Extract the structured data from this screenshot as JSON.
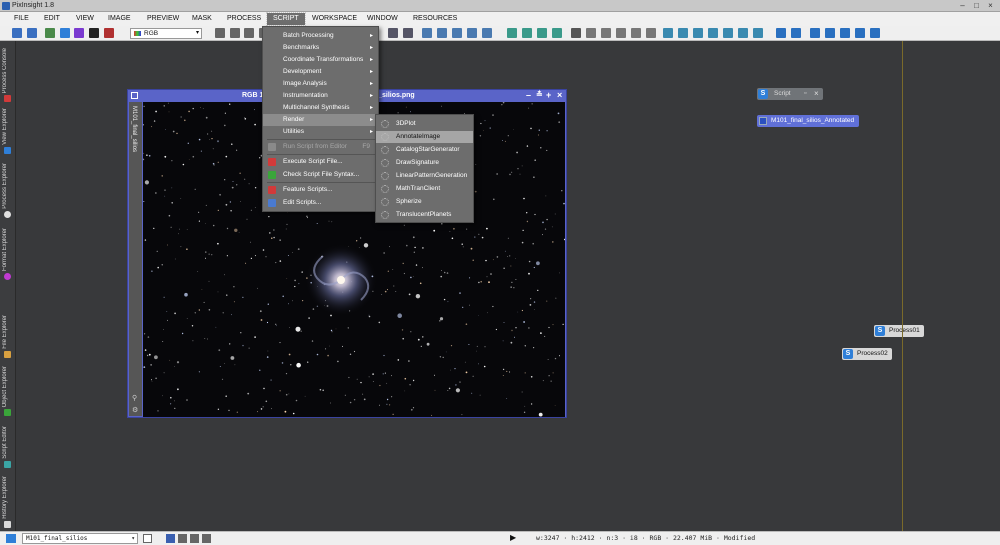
{
  "window": {
    "title": "PixInsight 1.8"
  },
  "menubar": {
    "items": [
      {
        "label": "FILE"
      },
      {
        "label": "EDIT"
      },
      {
        "label": "VIEW"
      },
      {
        "label": "IMAGE"
      },
      {
        "label": "PREVIEW"
      },
      {
        "label": "MASK"
      },
      {
        "label": "PROCESS"
      },
      {
        "label": "SCRIPT"
      },
      {
        "label": "WORKSPACE"
      },
      {
        "label": "WINDOW"
      },
      {
        "label": "RESOURCES"
      }
    ],
    "active": "SCRIPT"
  },
  "toolbar": {
    "channel_select": "RGB"
  },
  "sidebar": {
    "tabs": [
      {
        "label": "Process Console",
        "icon": "console-icon",
        "color": "#d23a3a"
      },
      {
        "label": "View Explorer",
        "icon": "view-explorer-icon",
        "color": "#2f7fd8"
      },
      {
        "label": "Process Explorer",
        "icon": "gear-icon",
        "color": "#e0e0e0"
      },
      {
        "label": "Format Explorer",
        "icon": "format-icon",
        "color": "#c03ad2"
      },
      {
        "label": "File Explorer",
        "icon": "folder-icon",
        "color": "#d8a040"
      },
      {
        "label": "Object Explorer",
        "icon": "cube-icon",
        "color": "#3aa53a"
      },
      {
        "label": "Script Editor",
        "icon": "script-editor-icon",
        "color": "#3aa5a5"
      },
      {
        "label": "History Explorer",
        "icon": "history-icon",
        "color": "#d8d8d8"
      }
    ]
  },
  "image_window": {
    "title_left": "RGB 1",
    "title_right": "nal_silios.png",
    "side_label": "M101_final_silios"
  },
  "script_menu": {
    "items": [
      {
        "label": "Batch Processing",
        "submenu": true
      },
      {
        "label": "Benchmarks",
        "submenu": true
      },
      {
        "label": "Coordinate Transformations",
        "submenu": true
      },
      {
        "label": "Development",
        "submenu": true
      },
      {
        "label": "Image Analysis",
        "submenu": true
      },
      {
        "label": "Instrumentation",
        "submenu": true
      },
      {
        "label": "Multichannel Synthesis",
        "submenu": true
      },
      {
        "label": "Render",
        "submenu": true
      },
      {
        "label": "Utilities",
        "submenu": true
      },
      {
        "label": "Run Script from Editor",
        "shortcut": "F9",
        "disabled": true
      },
      {
        "label": "Execute Script File..."
      },
      {
        "label": "Check Script File Syntax..."
      },
      {
        "label": "Feature Scripts..."
      },
      {
        "label": "Edit Scripts..."
      }
    ]
  },
  "render_submenu": {
    "items": [
      {
        "label": "3DPlot"
      },
      {
        "label": "AnnotateImage"
      },
      {
        "label": "CatalogStarGenerator"
      },
      {
        "label": "DrawSignature"
      },
      {
        "label": "LinearPatternGeneration"
      },
      {
        "label": "MathTranClient"
      },
      {
        "label": "Spherize"
      },
      {
        "label": "TranslucentPlanets"
      }
    ],
    "highlighted": "AnnotateImage"
  },
  "desktop": {
    "script_icon": "Script",
    "annotated_view": "M101_final_silios_Annotated",
    "process01": "Process01",
    "process02": "Process02"
  },
  "statusbar": {
    "view": "M101_final_silios",
    "info": "w:3247 · h:2412 · n:3 · i8 · RGB · 22.407 MiB · Modified"
  }
}
